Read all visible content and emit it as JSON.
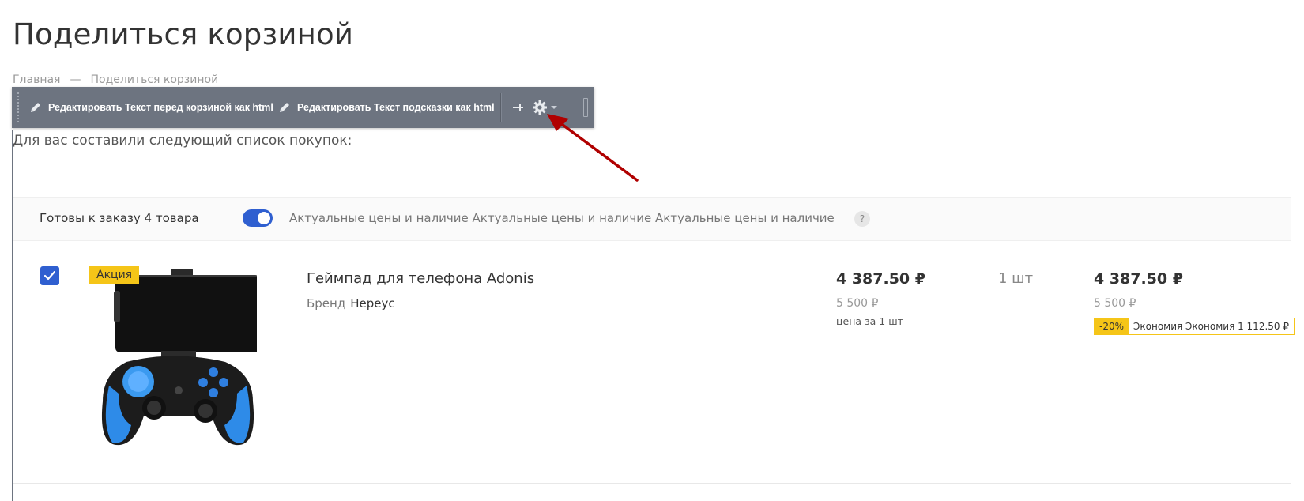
{
  "page": {
    "title": "Поделиться корзиной",
    "breadcrumb": {
      "home": "Главная",
      "separator": "—",
      "current": "Поделиться корзиной"
    }
  },
  "toolbar": {
    "edit_text_before": "Редактировать Текст перед корзиной как html",
    "edit_hint_text": "Редактировать Текст подсказки как html",
    "icons": [
      "pin-icon",
      "gear-icon",
      "chevron-down-icon",
      "resize-handle-icon"
    ]
  },
  "cart": {
    "intro": "Для вас составили следующий список покупок:",
    "ready_label": "Готовы к заказу 4 товара",
    "toggle_on": true,
    "actual_prices_label": "Актуальные цены и наличие Актуальные цены и наличие Актуальные цены и наличие",
    "help": "?"
  },
  "item": {
    "checked": true,
    "badge": "Акция",
    "name": "Геймпад для телефона Adonis",
    "brand_label": "Бренд",
    "brand_value": "Нереус",
    "price": "4 387.50 ₽",
    "old_price": "5 500 ₽",
    "per_unit": "цена за 1 шт",
    "quantity": "1 шт",
    "total": "4 387.50 ₽",
    "total_old": "5 500 ₽",
    "discount": "-20%",
    "economy": "Экономия Экономия 1 112.50 ₽"
  },
  "colors": {
    "accent_blue": "#2f5fd0",
    "badge_yellow": "#f5c518",
    "toolbar_bg": "#6d7480",
    "arrow_red": "#b00000"
  }
}
